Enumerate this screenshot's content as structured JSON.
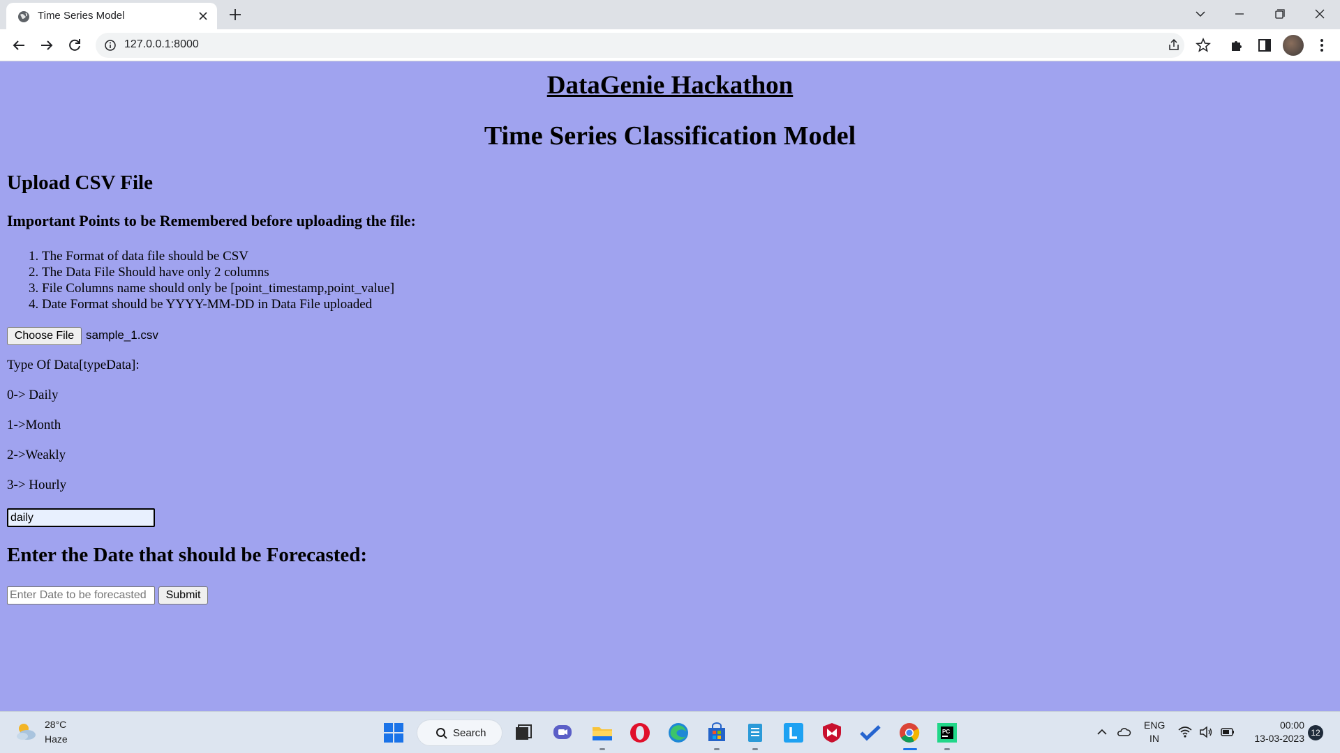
{
  "browser": {
    "tab_title": "Time Series Model",
    "url": "127.0.0.1:8000"
  },
  "page": {
    "hackathon_title": "DataGenie Hackathon",
    "model_title": "Time Series Classification Model",
    "upload_heading": "Upload CSV File",
    "points_heading": "Important Points to be Remembered before uploading the file:",
    "rules": [
      "The Format of data file should be CSV",
      "The Data File Should have only 2 columns",
      "File Columns name should only be [point_timestamp,point_value]",
      "Date Format should be YYYY-MM-DD in Data File uploaded"
    ],
    "file_button": "Choose File",
    "file_name": "sample_1.csv",
    "type_label": "Type Of Data[typeData]:",
    "type_options": [
      "0-> Daily",
      "1->Month",
      "2->Weakly",
      "3-> Hourly"
    ],
    "type_value": "daily",
    "date_heading": "Enter the Date that should be Forecasted:",
    "date_placeholder": "Enter Date to be forecasted",
    "submit_label": "Submit"
  },
  "taskbar": {
    "weather_temp": "28°C",
    "weather_desc": "Haze",
    "search_label": "Search",
    "lang_top": "ENG",
    "lang_bottom": "IN",
    "time": "00:00",
    "date": "13-03-2023",
    "notifications": "12"
  }
}
